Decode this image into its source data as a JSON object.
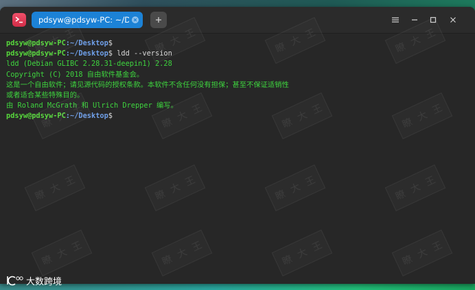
{
  "window": {
    "tab_title": "pdsyw@pdsyw-PC: ~/Desktop"
  },
  "icons": {
    "app": "terminal-icon",
    "tab_close": "close-icon",
    "add_tab": "plus-icon",
    "menu": "hamburger-menu-icon",
    "minimize": "minimize-icon",
    "maximize": "maximize-icon",
    "close": "close-icon"
  },
  "terminal": {
    "prompt_user": "pdsyw@pdsyw-PC",
    "prompt_path": ":~/Desktop",
    "prompt_symbol": "$",
    "command": " ldd --version",
    "output": [
      "ldd (Debian GLIBC 2.28.31-deepin1) 2.28",
      "Copyright (C) 2018 自由软件基金会。",
      "这是一个自由软件；请见源代码的授权条款。本软件不含任何没有担保；甚至不保证适销性",
      "或者适合某些特殊目的。",
      "由 Roland McGrath 和 Ulrich Drepper 编写。"
    ]
  },
  "watermark_text": [
    "瞭",
    "大",
    "王"
  ],
  "logo": {
    "text": "大数跨境"
  },
  "colors": {
    "tab_active": "#1c82d6",
    "prompt_user": "#57d83c",
    "prompt_path": "#6f9fe8",
    "output_text": "#3ed43e",
    "command_text": "#d8d8d8",
    "terminal_bg": "#272727"
  }
}
